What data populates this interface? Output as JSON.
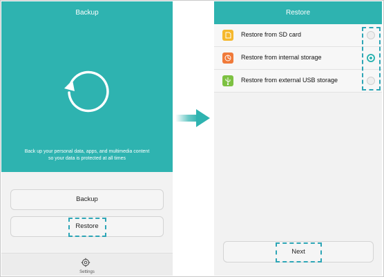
{
  "left_screen": {
    "title": "Backup",
    "description_line1": "Back up your personal data, apps, and multimedia content",
    "description_line2": "so your data is protected at all times",
    "backup_button": "Backup",
    "restore_button": "Restore",
    "settings_label": "Settings"
  },
  "right_screen": {
    "title": "Restore",
    "options": [
      {
        "label": "Restore from SD card",
        "icon": "sd-card-icon",
        "icon_color": "#f5b82e",
        "selected": false
      },
      {
        "label": "Restore from internal storage",
        "icon": "internal-storage-icon",
        "icon_color": "#f07a3a",
        "selected": true
      },
      {
        "label": "Restore from external USB storage",
        "icon": "usb-icon",
        "icon_color": "#7dc142",
        "selected": false
      }
    ],
    "next_button": "Next"
  },
  "colors": {
    "accent": "#2eb3b0",
    "highlight_dash": "#2ca5b6"
  }
}
